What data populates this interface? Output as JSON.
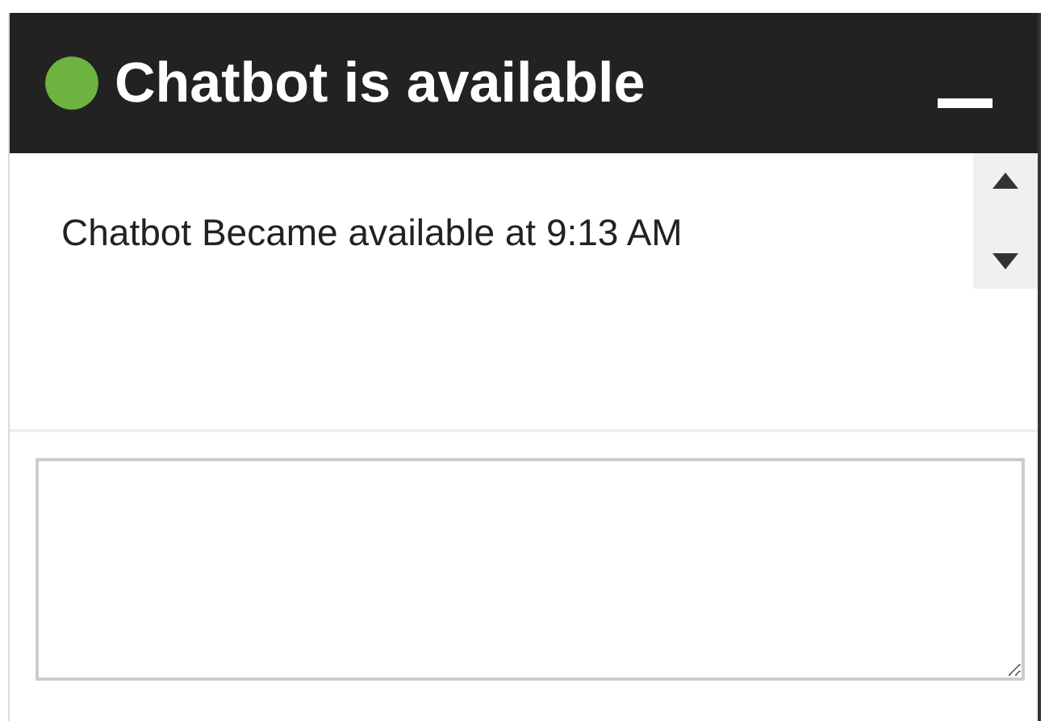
{
  "header": {
    "title": "Chatbot is available",
    "online": true
  },
  "messages": [
    {
      "text": "Chatbot Became available at 9:13 AM"
    }
  ],
  "composer": {
    "kind": "textarea"
  }
}
